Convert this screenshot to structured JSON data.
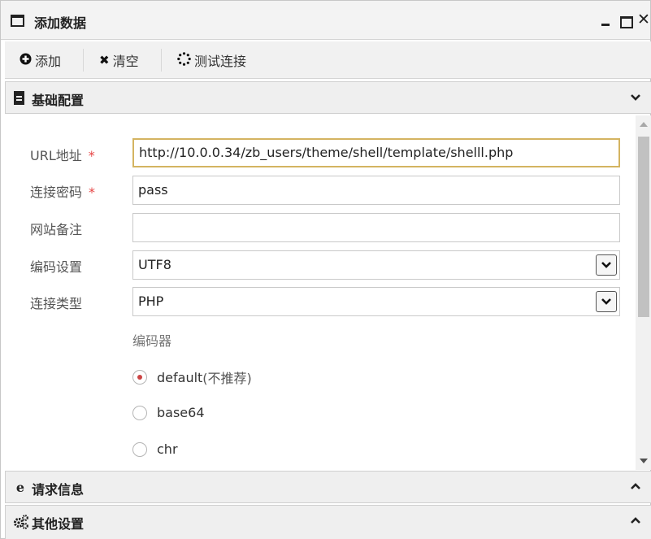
{
  "window": {
    "title": "添加数据"
  },
  "toolbar": {
    "add_label": "添加",
    "clear_label": "清空",
    "test_label": "测试连接"
  },
  "sections": {
    "basic": {
      "title": "基础配置"
    },
    "request": {
      "title": "请求信息"
    },
    "other": {
      "title": "其他设置"
    }
  },
  "form": {
    "url": {
      "label": "URL地址",
      "required": "*",
      "value": "http://10.0.0.34/zb_users/theme/shell/template/shelll.php"
    },
    "password": {
      "label": "连接密码",
      "required": "*",
      "value": "pass"
    },
    "note": {
      "label": "网站备注",
      "value": ""
    },
    "encoding": {
      "label": "编码设置",
      "value": "UTF8"
    },
    "type": {
      "label": "连接类型",
      "value": "PHP"
    },
    "encoder": {
      "title": "编码器",
      "options": [
        {
          "label": "default",
          "suffix": " (不推荐)",
          "checked": true
        },
        {
          "label": "base64",
          "suffix": "",
          "checked": false
        },
        {
          "label": "chr",
          "suffix": "",
          "checked": false
        }
      ]
    }
  },
  "colors": {
    "focus_border": "#d4b461",
    "required": "#e64545",
    "radio_dot": "#cc4444"
  }
}
